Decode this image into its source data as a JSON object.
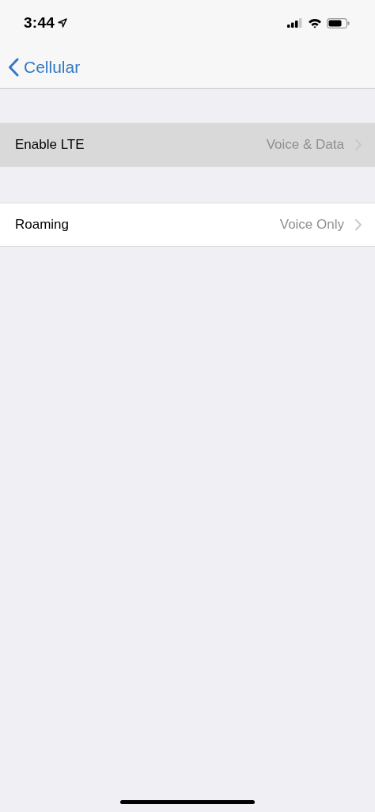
{
  "status_bar": {
    "time": "3:44"
  },
  "nav_bar": {
    "back_label": "Cellular"
  },
  "groups": [
    {
      "rows": [
        {
          "label": "Enable LTE",
          "value": "Voice & Data",
          "selected": true
        }
      ]
    },
    {
      "rows": [
        {
          "label": "Roaming",
          "value": "Voice Only",
          "selected": false
        }
      ]
    }
  ]
}
